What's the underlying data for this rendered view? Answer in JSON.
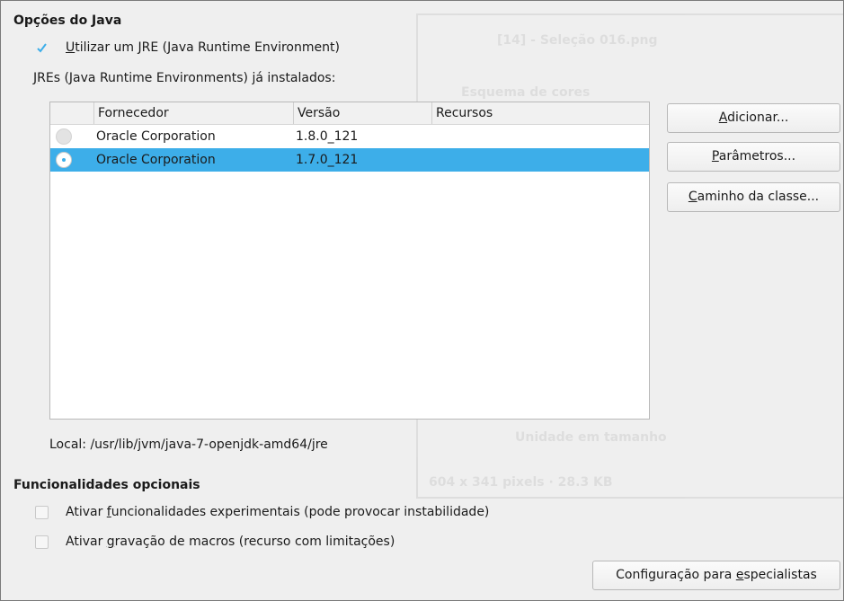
{
  "java_options": {
    "title": "Opções do Java",
    "use_jre_label": "Utilizar um JRE (Java Runtime Environment)",
    "use_jre_checked": true,
    "installed_label": "JREs (Java Runtime Environments) já instalados:",
    "columns": [
      "Fornecedor",
      "Versão",
      "Recursos"
    ],
    "rows": [
      {
        "vendor": "Oracle Corporation",
        "version": "1.8.0_121",
        "features": "",
        "selected": false
      },
      {
        "vendor": "Oracle Corporation",
        "version": "1.7.0_121",
        "features": "",
        "selected": true
      }
    ],
    "location": "Local: /usr/lib/jvm/java-7-openjdk-amd64/jre",
    "buttons": {
      "add": "Adicionar...",
      "params": "Parâmetros...",
      "classpath": "Caminho da classe..."
    }
  },
  "optional_features": {
    "title": "Funcionalidades opcionais",
    "experimental_label": "Ativar funcionalidades experimentais (pode provocar instabilidade)",
    "experimental_checked": false,
    "macro_label": "Ativar gravação de macros (recurso com limitações)",
    "macro_checked": false,
    "expert_button": "Configuração para especialistas"
  },
  "colors": {
    "accent": "#3daee9",
    "background": "#efefef"
  }
}
